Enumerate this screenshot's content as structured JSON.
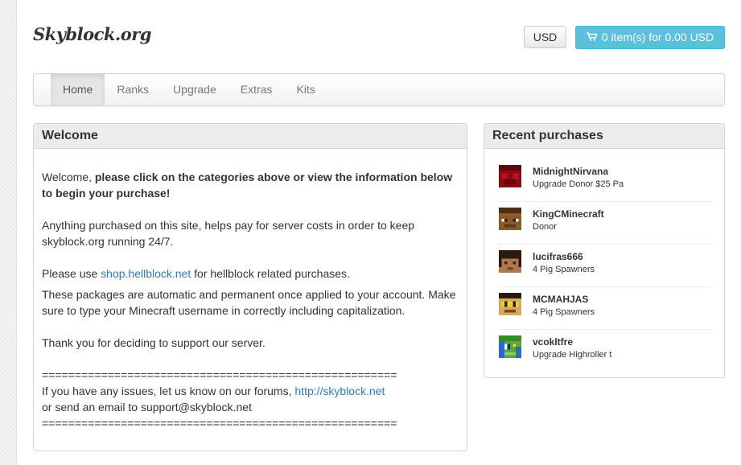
{
  "header": {
    "logo": "Skyblock.org",
    "currency": "USD",
    "cart_label": "0 item(s) for 0.00 USD"
  },
  "nav": {
    "items": [
      "Home",
      "Ranks",
      "Upgrade",
      "Extras",
      "Kits"
    ],
    "active": "Home"
  },
  "welcome": {
    "title": "Welcome",
    "intro_plain": "Welcome, ",
    "intro_bold": "please click on the categories above or view the information below to begin your purchase!",
    "p2": "Anything purchased on this site, helps pay for server costs in order to keep skyblock.org running 24/7.",
    "p3_before": "Please use ",
    "p3_link": "shop.hellblock.net",
    "p3_after": " for hellblock related purchases.",
    "p4": "These packages are automatic and permanent once applied to your account. Make sure to type your Minecraft username in correctly including capitalization.",
    "p5": "Thank you for deciding to support our server.",
    "divider": "======================================================",
    "issues_before": "If you have any issues, let us know on our forums, ",
    "issues_link": "http://skyblock.net",
    "email_line": "or send an email to support@skyblock.net"
  },
  "recent": {
    "title": "Recent purchases",
    "items": [
      {
        "name": "MidnightNirvana",
        "package": "Upgrade Donor $25 Pa",
        "avatar_icon": "red-skin-avatar-icon"
      },
      {
        "name": "KingCMinecraft",
        "package": "Donor",
        "avatar_icon": "brown-skin-avatar-icon"
      },
      {
        "name": "lucifras666",
        "package": "4 Pig Spawners",
        "avatar_icon": "dark-hair-avatar-icon"
      },
      {
        "name": "MCMAHJAS",
        "package": "4 Pig Spawners",
        "avatar_icon": "yellow-skin-avatar-icon"
      },
      {
        "name": "vcokltfre",
        "package": "Upgrade Highroller t",
        "avatar_icon": "green-blue-avatar-icon"
      }
    ]
  },
  "colors": {
    "accent": "#5bc0de",
    "link": "#2a7bc0"
  }
}
